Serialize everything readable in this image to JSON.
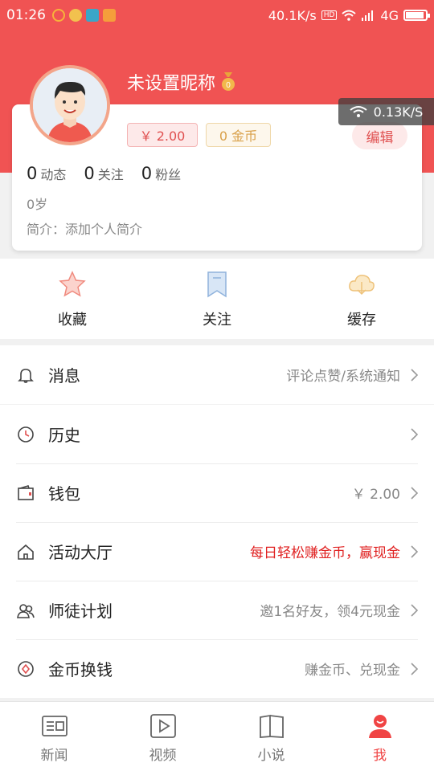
{
  "status_bar": {
    "time": "01:26",
    "speed": "40.1K/s",
    "hd": "HD",
    "network": "4G"
  },
  "profile": {
    "nickname": "未设置昵称",
    "badge_level": "0",
    "net_speed_overlay": "0.13K/S",
    "money": "￥ 2.00",
    "coins": "0 金币",
    "edit_label": "编辑",
    "stats": [
      {
        "num": "0",
        "label": "动态"
      },
      {
        "num": "0",
        "label": "关注"
      },
      {
        "num": "0",
        "label": "粉丝"
      }
    ],
    "age": "0岁",
    "intro": "简介：添加个人简介"
  },
  "quick_actions": [
    {
      "label": "收藏",
      "icon": "star-icon"
    },
    {
      "label": "关注",
      "icon": "bookmark-icon"
    },
    {
      "label": "缓存",
      "icon": "cloud-download-icon"
    }
  ],
  "menu": {
    "message": {
      "label": "消息",
      "right": "评论点赞/系统通知"
    },
    "history": {
      "label": "历史",
      "right": ""
    },
    "wallet": {
      "label": "钱包",
      "right": "￥ 2.00"
    },
    "activity": {
      "label": "活动大厅",
      "right": "每日轻松赚金币，赢现金"
    },
    "mentor": {
      "label": "师徒计划",
      "right": "邀1名好友，领4元现金"
    },
    "exchange": {
      "label": "金币换钱",
      "right": "赚金币、兑现金"
    }
  },
  "tabs": [
    {
      "label": "新闻",
      "icon": "news-icon"
    },
    {
      "label": "视频",
      "icon": "video-icon"
    },
    {
      "label": "小说",
      "icon": "book-icon"
    },
    {
      "label": "我",
      "icon": "user-icon",
      "active": true
    }
  ],
  "colors": {
    "brand": "#f05353",
    "accent_red": "#e02020",
    "coin": "#d9a04a"
  }
}
